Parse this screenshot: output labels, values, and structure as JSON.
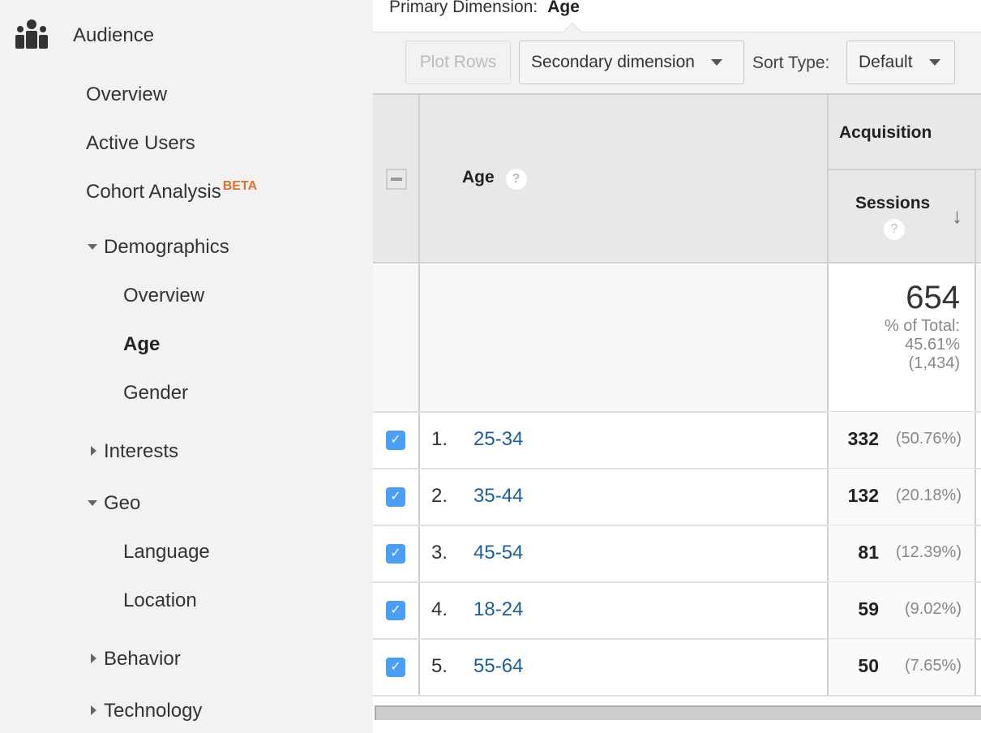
{
  "sidebar": {
    "section_label": "Audience",
    "section_icon": "audience-icon",
    "items": [
      {
        "label": "Overview"
      },
      {
        "label": "Active Users"
      },
      {
        "label": "Cohort Analysis",
        "badge": "BETA"
      },
      {
        "label": "Demographics",
        "expanded": true,
        "children": [
          {
            "label": "Overview"
          },
          {
            "label": "Age",
            "active": true
          },
          {
            "label": "Gender"
          }
        ]
      },
      {
        "label": "Interests",
        "expanded": false
      },
      {
        "label": "Geo",
        "expanded": true,
        "children": [
          {
            "label": "Language"
          },
          {
            "label": "Location"
          }
        ]
      },
      {
        "label": "Behavior",
        "expanded": false
      },
      {
        "label": "Technology",
        "expanded": false
      }
    ]
  },
  "main": {
    "primary_dimension_label": "Primary Dimension:",
    "primary_dimension_value": "Age",
    "toolbar": {
      "plot_rows_label": "Plot Rows",
      "secondary_dimension_label": "Secondary dimension",
      "sort_type_label": "Sort Type:",
      "sort_type_value": "Default"
    },
    "table": {
      "dimension_header": "Age",
      "group_header": "Acquisition",
      "metric_header": "Sessions",
      "help_glyph": "?",
      "sort_glyph": "↓",
      "total": {
        "value": "654",
        "pct_label": "% of Total:",
        "pct_value": "45.61%",
        "overall": "(1,434)"
      },
      "rows": [
        {
          "index": "1.",
          "age": "25-34",
          "sessions": "332",
          "pct": "(50.76%)",
          "checked": true
        },
        {
          "index": "2.",
          "age": "35-44",
          "sessions": "132",
          "pct": "(20.18%)",
          "checked": true
        },
        {
          "index": "3.",
          "age": "45-54",
          "sessions": "81",
          "pct": "(12.39%)",
          "checked": true
        },
        {
          "index": "4.",
          "age": "18-24",
          "sessions": "59",
          "pct": "(9.02%)",
          "checked": true
        },
        {
          "index": "5.",
          "age": "55-64",
          "sessions": "50",
          "pct": "(7.65%)",
          "checked": true
        }
      ],
      "checkmark_glyph": "✓"
    }
  },
  "colors": {
    "link": "#1a5e9a",
    "checkbox": "#4a9ff5",
    "beta_badge": "#e07030",
    "sidebar_bg": "#f2f2f2"
  }
}
